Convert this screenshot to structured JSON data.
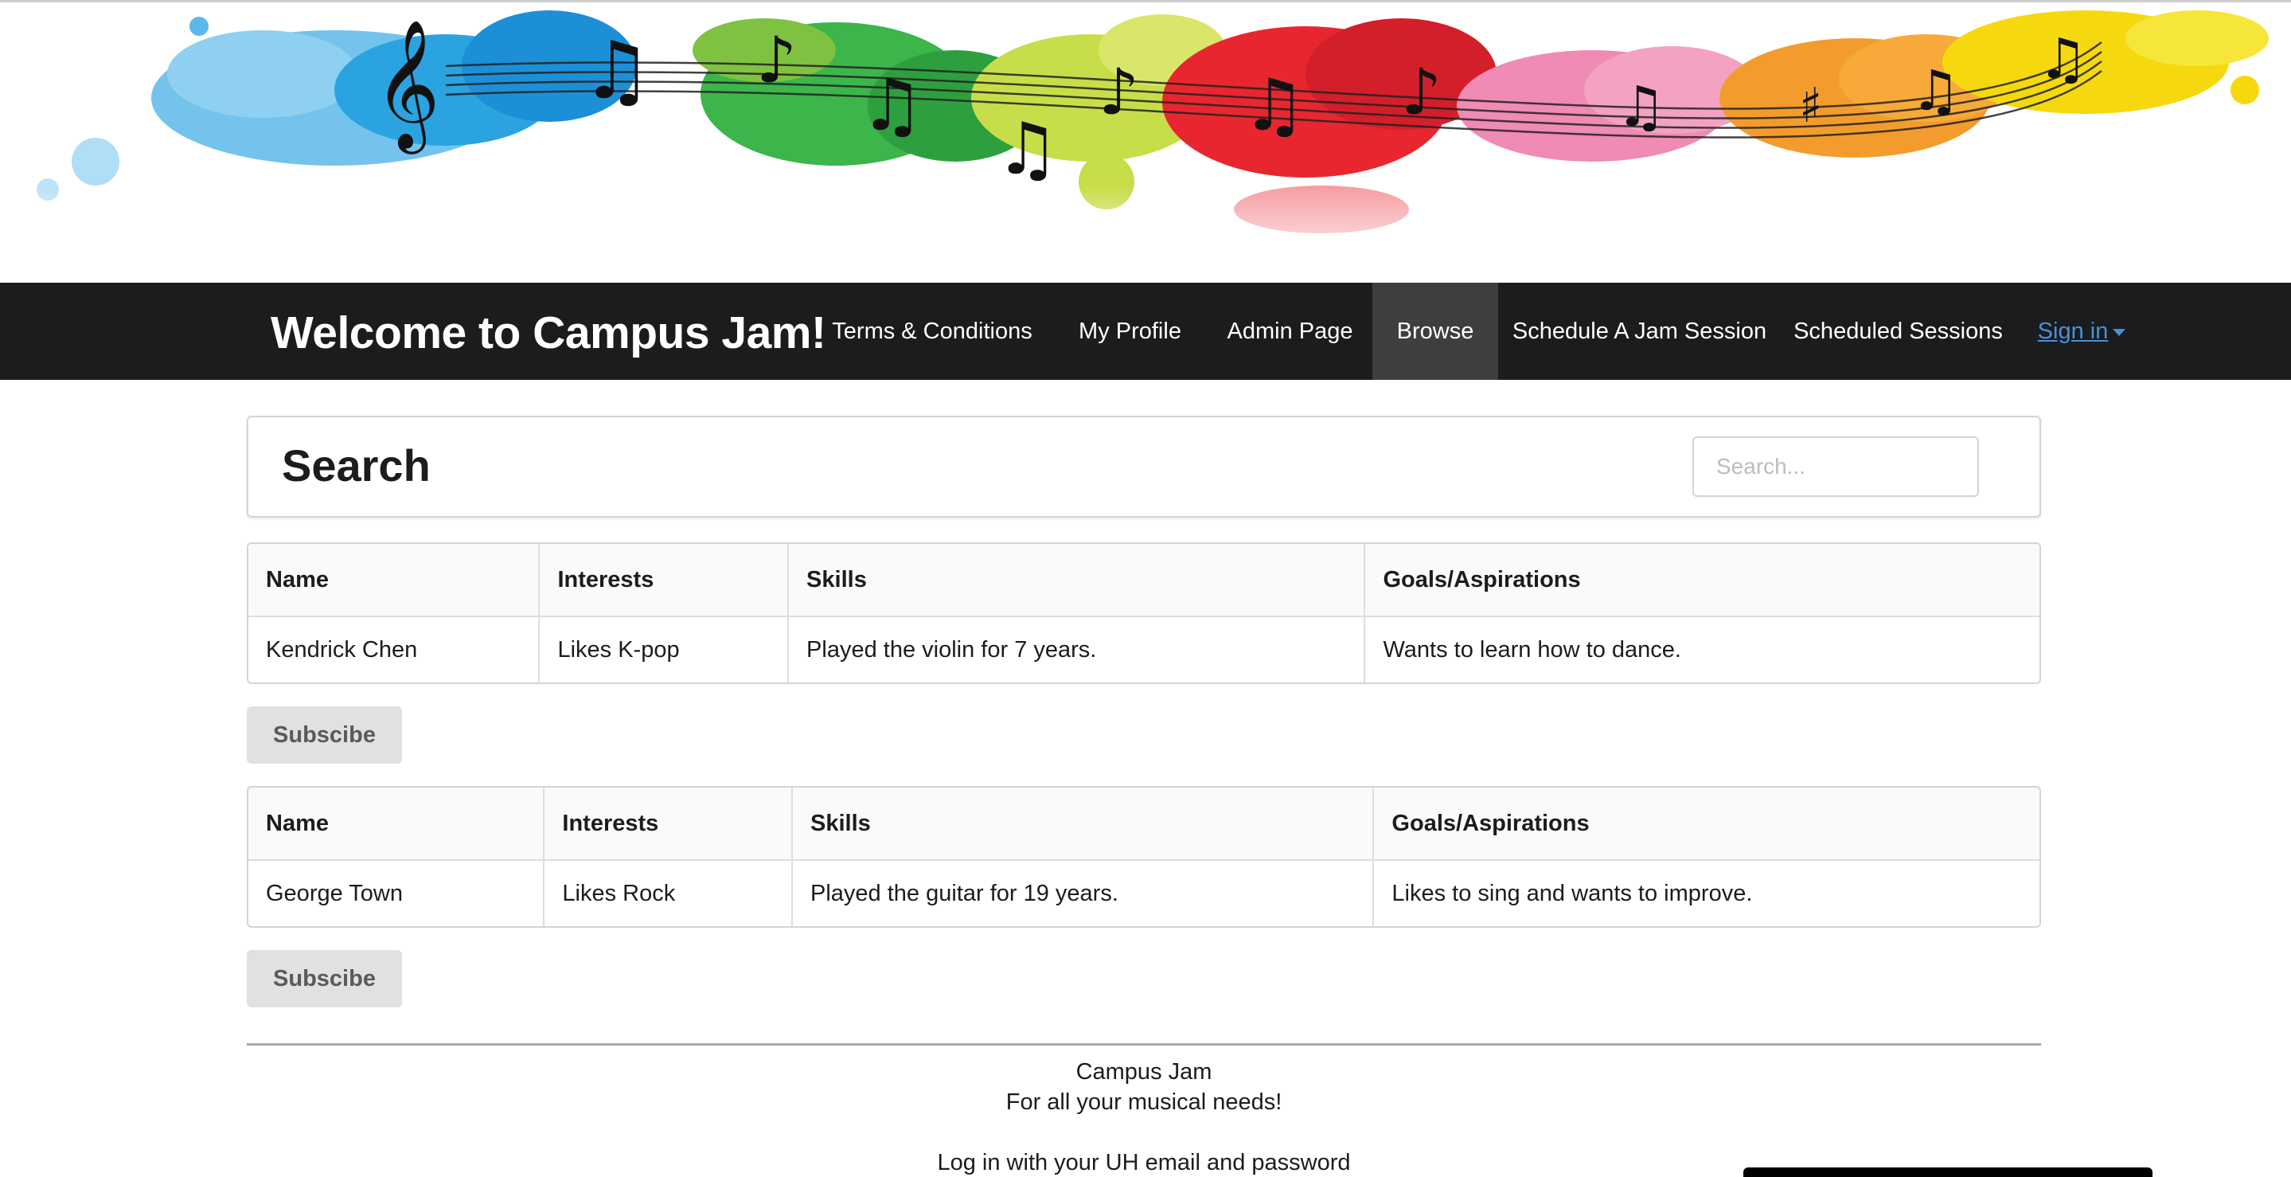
{
  "header": {
    "brand": "Welcome to Campus Jam!",
    "nav": [
      {
        "label": "Terms & Conditions"
      },
      {
        "label": "My Profile"
      },
      {
        "label": "Admin Page"
      },
      {
        "label": "Browse",
        "active": true
      },
      {
        "label": "Schedule A Jam Session"
      },
      {
        "label": "Scheduled Sessions"
      }
    ],
    "signin": "Sign in",
    "signin_color": "#4a90d9",
    "navbar_color": "#1b1c1d"
  },
  "banner": {
    "icon": "paint-splash-music-notes-banner"
  },
  "search": {
    "title": "Search",
    "placeholder": "Search..."
  },
  "columns": [
    "Name",
    "Interests",
    "Skills",
    "Goals/Aspirations"
  ],
  "results": [
    {
      "name": "Kendrick Chen",
      "interests": "Likes K-pop",
      "skills": "Played the violin for 7 years.",
      "goals": "Wants to learn how to dance.",
      "button": "Subscibe"
    },
    {
      "name": "George Town",
      "interests": "Likes Rock",
      "skills": "Played the guitar for 19 years.",
      "goals": "Likes to sing and wants to improve.",
      "button": "Subscibe"
    }
  ],
  "footer": {
    "line1": "Campus Jam",
    "line2": "For all your musical needs!",
    "line3": "Log in with your UH email and password"
  }
}
